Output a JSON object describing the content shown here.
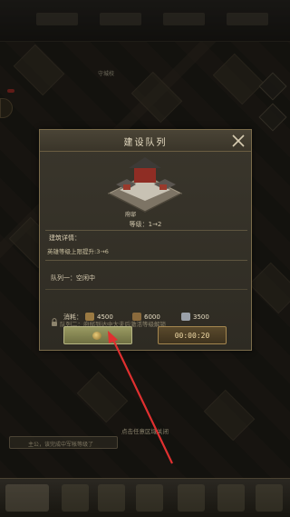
{
  "dialog": {
    "title": "建设队列",
    "building_name": "府邸",
    "level_text": "等级：1→2",
    "details_title": "建筑详情：",
    "details_text": "英雄等级上限提升:3→6",
    "queue1_text": "队列一：空闲中",
    "queue2_text": "队列二：府邸到达中大夫后激活等级解锁"
  },
  "cost": {
    "label": "消耗：",
    "items": [
      {
        "icon": "wood-icon",
        "value": "4500",
        "color": "#9b7a42"
      },
      {
        "icon": "grain-icon",
        "value": "6000",
        "color": "#8a6a3c"
      },
      {
        "icon": "iron-icon",
        "value": "3500",
        "color": "#9aa0a8"
      }
    ]
  },
  "buttons": {
    "timer_label": "00:00:20"
  },
  "dismiss_hint": "点击任意区域关闭",
  "map_label": "守城校",
  "bottom_notice": "主公，该完成中军帐等级了",
  "annotation_color": "#e03030"
}
